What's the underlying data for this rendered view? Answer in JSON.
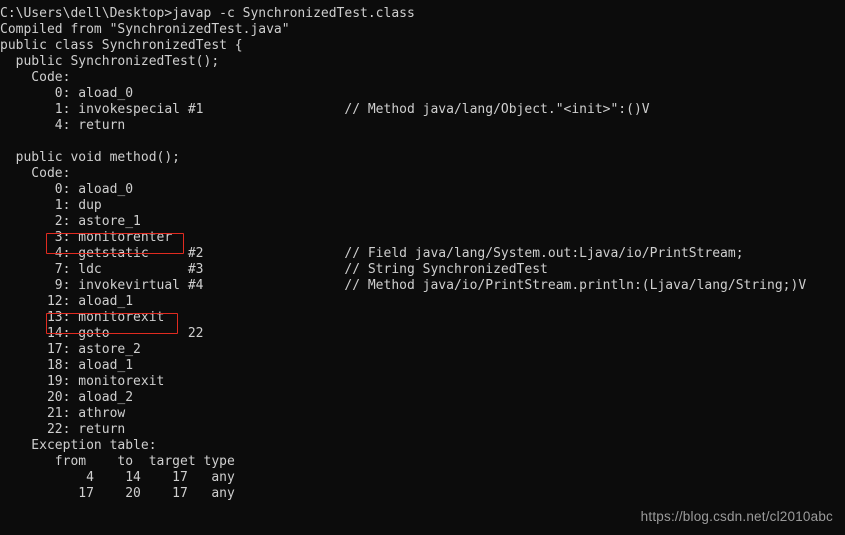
{
  "window": {
    "type": "windows-command-prompt",
    "background_color": "#0c0c0c",
    "text_color": "#cfcfcf",
    "highlight_color": "#e02b20"
  },
  "terminal": {
    "prompt_line": "C:\\Users\\dell\\Desktop>javap -c SynchronizedTest.class",
    "lines": [
      "C:\\Users\\dell\\Desktop>javap -c SynchronizedTest.class",
      "Compiled from \"SynchronizedTest.java\"",
      "public class SynchronizedTest {",
      "  public SynchronizedTest();",
      "    Code:",
      "       0: aload_0",
      "       1: invokespecial #1                  // Method java/lang/Object.\"<init>\":()V",
      "       4: return",
      "",
      "  public void method();",
      "    Code:",
      "       0: aload_0",
      "       1: dup",
      "       2: astore_1",
      "       3: monitorenter",
      "       4: getstatic     #2                  // Field java/lang/System.out:Ljava/io/PrintStream;",
      "       7: ldc           #3                  // String SynchronizedTest",
      "       9: invokevirtual #4                  // Method java/io/PrintStream.println:(Ljava/lang/String;)V",
      "      12: aload_1",
      "      13: monitorexit",
      "      14: goto          22",
      "      17: astore_2",
      "      18: aload_1",
      "      19: monitorexit",
      "      20: aload_2",
      "      21: athrow",
      "      22: return",
      "    Exception table:",
      "       from    to  target type",
      "           4    14    17   any",
      "          17    20    17   any",
      "}"
    ]
  },
  "bytecode": {
    "command": "javap -c SynchronizedTest.class",
    "compiled_from": "SynchronizedTest.java",
    "class_declaration": "public class SynchronizedTest {",
    "class_closing_brace": "}",
    "methods": [
      {
        "signature": "public SynchronizedTest();",
        "code_label": "Code:",
        "instructions": [
          {
            "offset": "0",
            "mnemonic": "aload_0",
            "operand": "",
            "comment": ""
          },
          {
            "offset": "1",
            "mnemonic": "invokespecial",
            "operand": "#1",
            "comment": "// Method java/lang/Object.\"<init>\":()V"
          },
          {
            "offset": "4",
            "mnemonic": "return",
            "operand": "",
            "comment": ""
          }
        ]
      },
      {
        "signature": "public void method();",
        "code_label": "Code:",
        "instructions": [
          {
            "offset": "0",
            "mnemonic": "aload_0",
            "operand": "",
            "comment": ""
          },
          {
            "offset": "1",
            "mnemonic": "dup",
            "operand": "",
            "comment": ""
          },
          {
            "offset": "2",
            "mnemonic": "astore_1",
            "operand": "",
            "comment": ""
          },
          {
            "offset": "3",
            "mnemonic": "monitorenter",
            "operand": "",
            "comment": "",
            "highlighted": true
          },
          {
            "offset": "4",
            "mnemonic": "getstatic",
            "operand": "#2",
            "comment": "// Field java/lang/System.out:Ljava/io/PrintStream;"
          },
          {
            "offset": "7",
            "mnemonic": "ldc",
            "operand": "#3",
            "comment": "// String SynchronizedTest"
          },
          {
            "offset": "9",
            "mnemonic": "invokevirtual",
            "operand": "#4",
            "comment": "// Method java/io/PrintStream.println:(Ljava/lang/String;)V"
          },
          {
            "offset": "12",
            "mnemonic": "aload_1",
            "operand": "",
            "comment": ""
          },
          {
            "offset": "13",
            "mnemonic": "monitorexit",
            "operand": "",
            "comment": "",
            "highlighted": true
          },
          {
            "offset": "14",
            "mnemonic": "goto",
            "operand": "22",
            "comment": ""
          },
          {
            "offset": "17",
            "mnemonic": "astore_2",
            "operand": "",
            "comment": ""
          },
          {
            "offset": "18",
            "mnemonic": "aload_1",
            "operand": "",
            "comment": ""
          },
          {
            "offset": "19",
            "mnemonic": "monitorexit",
            "operand": "",
            "comment": ""
          },
          {
            "offset": "20",
            "mnemonic": "aload_2",
            "operand": "",
            "comment": ""
          },
          {
            "offset": "21",
            "mnemonic": "athrow",
            "operand": "",
            "comment": ""
          },
          {
            "offset": "22",
            "mnemonic": "return",
            "operand": "",
            "comment": ""
          }
        ],
        "exception_table": {
          "label": "Exception table:",
          "headers": [
            "from",
            "to",
            "target",
            "type"
          ],
          "rows": [
            [
              "4",
              "14",
              "17",
              "any"
            ],
            [
              "17",
              "20",
              "17",
              "any"
            ]
          ]
        }
      }
    ]
  },
  "annotations": {
    "boxes": [
      {
        "name": "monitorenter-highlight",
        "text": "3: monitorenter"
      },
      {
        "name": "monitorexit-highlight",
        "text": "13: monitorexit"
      }
    ]
  },
  "watermark": {
    "text": "https://blog.csdn.net/cl2010abc"
  }
}
